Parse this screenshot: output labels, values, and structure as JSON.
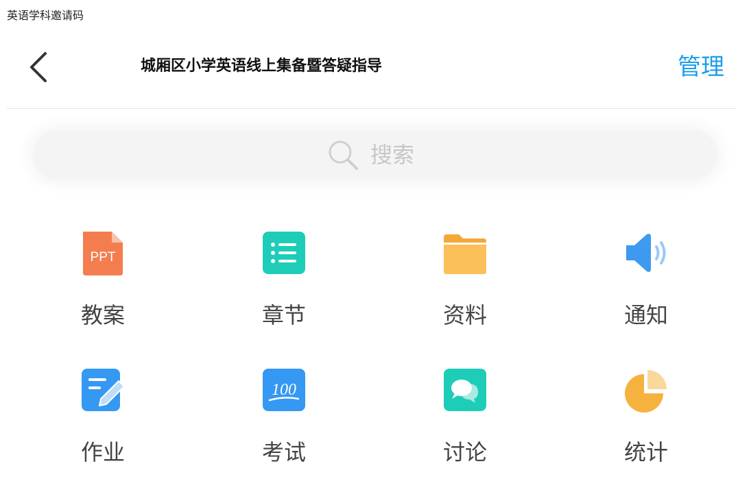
{
  "caption": "英语学科邀请码",
  "header": {
    "title": "城厢区小学英语线上集备暨答疑指导",
    "manage_label": "管理"
  },
  "search": {
    "placeholder": "搜索"
  },
  "modules": [
    {
      "label": "教案",
      "icon": "ppt-icon",
      "icon_text": "PPT",
      "color": "#F47D50"
    },
    {
      "label": "章节",
      "icon": "list-icon",
      "color": "#1ECDB8"
    },
    {
      "label": "资料",
      "icon": "folder-icon",
      "color": "#F9B24A"
    },
    {
      "label": "通知",
      "icon": "speaker-icon",
      "color": "#3D9AF0"
    },
    {
      "label": "作业",
      "icon": "homework-icon",
      "color": "#3598F2"
    },
    {
      "label": "考试",
      "icon": "exam-icon",
      "icon_text": "100",
      "color": "#3598F2"
    },
    {
      "label": "讨论",
      "icon": "discussion-icon",
      "color": "#1ECDB8"
    },
    {
      "label": "统计",
      "icon": "pie-chart-icon",
      "color": "#F6B23F"
    }
  ],
  "colors": {
    "accent": "#1E9DEB",
    "label": "#444444"
  }
}
